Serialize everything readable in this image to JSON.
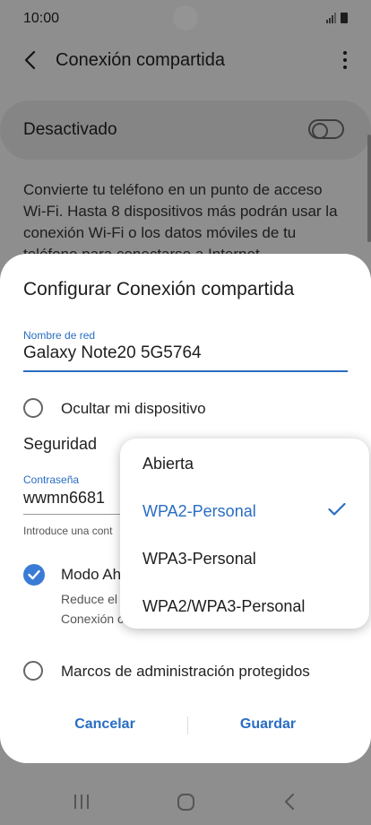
{
  "status": {
    "time": "10:00"
  },
  "appbar": {
    "title": "Conexión compartida"
  },
  "master": {
    "label": "Desactivado",
    "enabled": false
  },
  "description": "Convierte tu teléfono en un punto de acceso Wi-Fi. Hasta 8 dispositivos más podrán usar la conexión Wi-Fi o los datos móviles de tu teléfono para conectarse a Internet.",
  "dialog": {
    "title": "Configurar Conexión compartida",
    "network_name_label": "Nombre de red",
    "network_name_value": "Galaxy Note20 5G5764",
    "hide_device_label": "Ocultar mi dispositivo",
    "hide_device_checked": false,
    "security_label": "Seguridad",
    "password_label": "Contraseña",
    "password_value": "wwmn6681",
    "password_hint": "Introduce una cont",
    "power_saving_label": "Modo Ah",
    "power_saving_checked": true,
    "power_saving_desc_line1": "Reduce el",
    "power_saving_desc_line2": "Conexión c",
    "pmf_label": "Marcos de administración protegidos",
    "pmf_checked": false,
    "cancel_label": "Cancelar",
    "save_label": "Guardar"
  },
  "security_menu": {
    "options": [
      "Abierta",
      "WPA2-Personal",
      "WPA3-Personal",
      "WPA2/WPA3-Personal"
    ],
    "selected": "WPA2-Personal"
  },
  "colors": {
    "accent": "#2a6dc2",
    "check_fill": "#3a7bd5"
  },
  "icons": [
    "back-icon",
    "more-icon",
    "radio-icon",
    "check-circle-icon",
    "checkmark-icon",
    "recent-apps-icon",
    "home-icon",
    "nav-back-icon"
  ]
}
